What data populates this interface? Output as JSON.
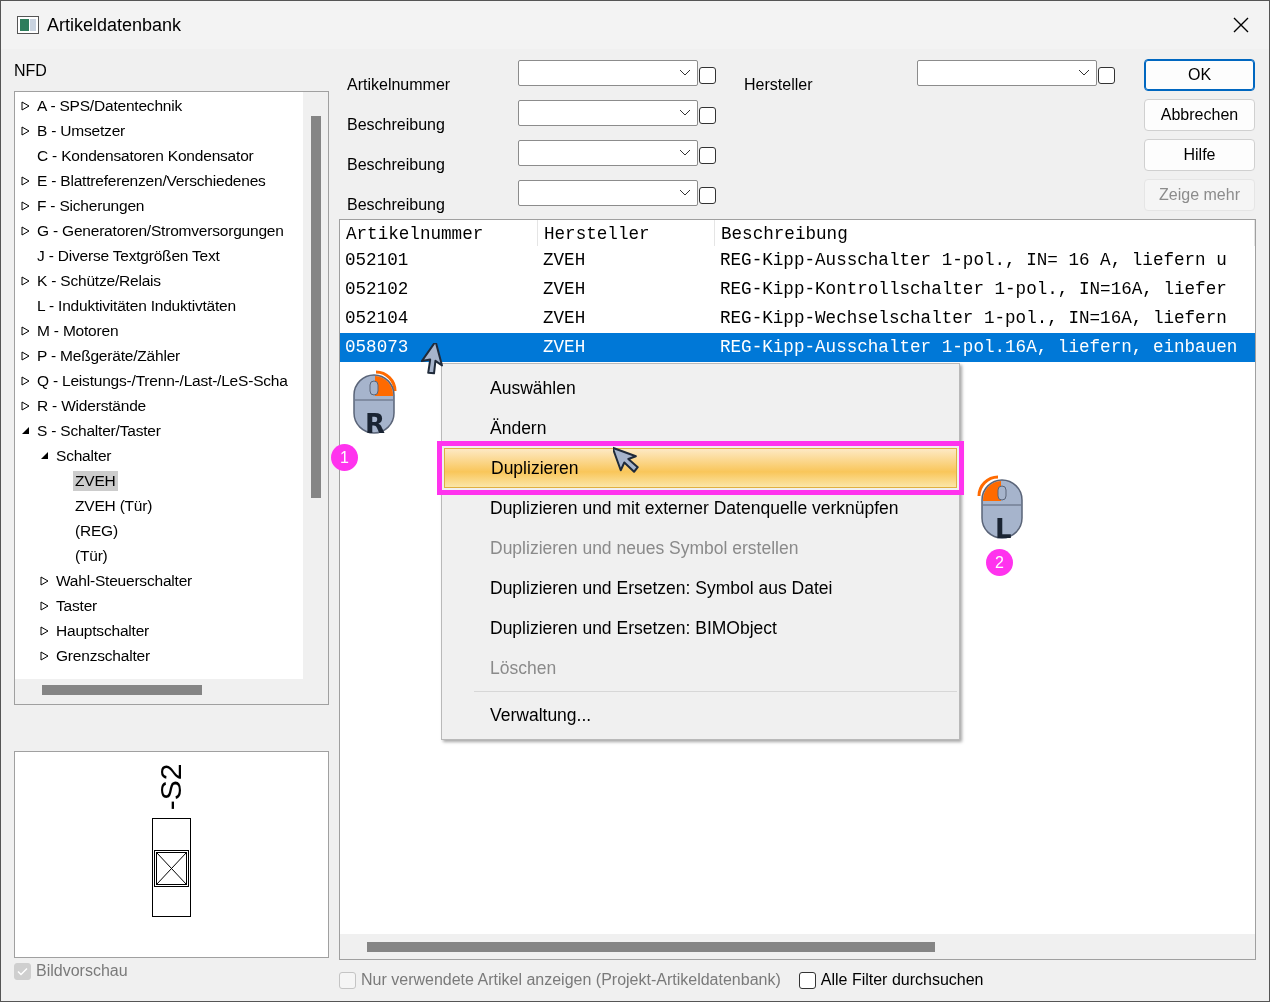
{
  "window": {
    "title": "Artikeldatenbank"
  },
  "tree": {
    "label": "NFD",
    "items": [
      {
        "label": "A - SPS/Datentechnik",
        "expanded": false,
        "selected": false
      },
      {
        "label": "B - Umsetzer",
        "expanded": false,
        "selected": false
      },
      {
        "label": "C - Kondensatoren Kondensator",
        "selected": false
      },
      {
        "label": "E - Blattreferenzen/Verschiedenes",
        "expanded": false,
        "selected": false
      },
      {
        "label": "F - Sicherungen",
        "expanded": false,
        "selected": false
      },
      {
        "label": "G - Generatoren/Stromversorgungen",
        "expanded": false,
        "selected": false
      },
      {
        "label": "J - Diverse Textgrößen Text",
        "selected": false
      },
      {
        "label": "K - Schütze/Relais",
        "expanded": false,
        "selected": false
      },
      {
        "label": "L - Induktivitäten Induktivtäten",
        "selected": false
      },
      {
        "label": "M - Motoren",
        "expanded": false,
        "selected": false
      },
      {
        "label": "P - Meßgeräte/Zähler",
        "expanded": false,
        "selected": false
      },
      {
        "label": "Q - Leistungs-/Trenn-/Last-/LeS-Scha",
        "expanded": false,
        "selected": false
      },
      {
        "label": "R - Widerstände",
        "expanded": false,
        "selected": false
      },
      {
        "label": "S - Schalter/Taster",
        "expanded": true,
        "selected": false,
        "children": [
          {
            "label": "Schalter",
            "expanded": true,
            "selected": false,
            "children": [
              {
                "label": "ZVEH",
                "selected": true
              },
              {
                "label": "ZVEH (Tür)",
                "selected": false
              },
              {
                "label": "(REG)",
                "selected": false
              },
              {
                "label": "(Tür)",
                "selected": false
              }
            ]
          },
          {
            "label": "Wahl-Steuerschalter",
            "expanded": false,
            "selected": false
          },
          {
            "label": "Taster",
            "expanded": false,
            "selected": false
          },
          {
            "label": "Hauptschalter",
            "expanded": false,
            "selected": false
          },
          {
            "label": "Grenzschalter",
            "expanded": false,
            "selected": false
          }
        ]
      }
    ]
  },
  "preview": {
    "designation": "-S2"
  },
  "filters_left": [
    {
      "label": "Artikelnummer",
      "checked": false
    },
    {
      "label": "Beschreibung",
      "checked": false
    },
    {
      "label": "Beschreibung",
      "checked": false
    },
    {
      "label": "Beschreibung",
      "checked": false
    }
  ],
  "filters_right": [
    {
      "label": "Hersteller",
      "checked": false
    }
  ],
  "buttons": [
    {
      "label": "OK",
      "default": true,
      "disabled": false
    },
    {
      "label": "Abbrechen",
      "default": false,
      "disabled": false
    },
    {
      "label": "Hilfe",
      "default": false,
      "disabled": false
    },
    {
      "label": "Zeige mehr",
      "default": false,
      "disabled": true
    }
  ],
  "table": {
    "columns": [
      "Artikelnummer",
      "Hersteller",
      "Beschreibung"
    ],
    "rows": [
      {
        "cells": [
          "052101",
          "ZVEH",
          "REG-Kipp-Ausschalter 1-pol., IN= 16 A, liefern u"
        ],
        "selected": false
      },
      {
        "cells": [
          "052102",
          "ZVEH",
          "REG-Kipp-Kontrollschalter 1-pol., IN=16A, liefer"
        ],
        "selected": false
      },
      {
        "cells": [
          "052104",
          "ZVEH",
          "REG-Kipp-Wechselschalter 1-pol., IN=16A, liefern"
        ],
        "selected": false
      },
      {
        "cells": [
          "058073",
          "ZVEH",
          "REG-Kipp-Ausschalter 1-pol.16A, liefern, einbauen"
        ],
        "selected": true
      }
    ]
  },
  "context_menu": [
    {
      "label": "Auswählen",
      "disabled": false,
      "selected": false,
      "framed": false
    },
    {
      "label": "Ändern",
      "disabled": false,
      "selected": false,
      "framed": false
    },
    {
      "label": "Duplizieren",
      "disabled": false,
      "selected": true,
      "framed": true
    },
    {
      "label": "Duplizieren und mit externer Datenquelle verknüpfen",
      "disabled": false,
      "selected": false,
      "framed": false
    },
    {
      "label": "Duplizieren und neues Symbol erstellen",
      "disabled": true,
      "selected": false,
      "framed": false
    },
    {
      "label": "Duplizieren und Ersetzen: Symbol aus Datei",
      "disabled": false,
      "selected": false,
      "framed": false
    },
    {
      "label": "Duplizieren und Ersetzen: BIMObject",
      "disabled": false,
      "selected": false,
      "framed": false
    },
    {
      "label": "Löschen",
      "disabled": true,
      "selected": false,
      "framed": false
    },
    {
      "label": "Verwaltung...",
      "disabled": false,
      "selected": false,
      "framed": false,
      "separator_before": true
    }
  ],
  "annotations": [
    {
      "kind": "right-click",
      "mouse_label": "R",
      "step": "1"
    },
    {
      "kind": "left-click",
      "mouse_label": "L",
      "step": "2"
    }
  ],
  "options": [
    {
      "label": "Bildvorschau",
      "checked": true,
      "disabled": true
    },
    {
      "label": "Nur verwendete Artikel anzeigen (Projekt-Artikeldatenbank)",
      "checked": false,
      "disabled": true
    },
    {
      "label": "Alle Filter durchsuchen",
      "checked": false,
      "disabled": false
    }
  ]
}
